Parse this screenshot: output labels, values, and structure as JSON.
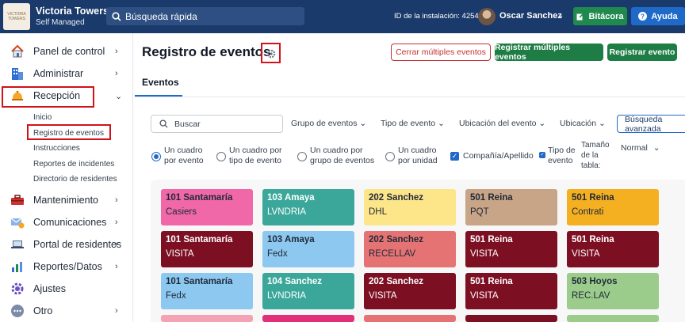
{
  "topbar": {
    "logo_text": "VICTORIA TOWERS",
    "brand_name": "Victoria Towers",
    "brand_sub": "Self Managed",
    "search_placeholder": "Búsqueda rápida",
    "install_id": "ID de la instalación: 4254",
    "user_name": "Oscar Sanchez",
    "bitacora_label": "Bitácora",
    "ayuda_label": "Ayuda",
    "colors": {
      "bar": "#1a3a6b",
      "bitacora": "#20894e",
      "ayuda": "#1f6ac9"
    }
  },
  "sidebar": {
    "items": [
      {
        "label": "Panel de control",
        "icon": "house-icon"
      },
      {
        "label": "Administrar",
        "icon": "building-icon"
      },
      {
        "label": "Recepción",
        "icon": "bell-icon"
      },
      {
        "label": "Mantenimiento",
        "icon": "toolbox-icon"
      },
      {
        "label": "Comunicaciones",
        "icon": "mail-icon"
      },
      {
        "label": "Portal de residentes",
        "icon": "laptop-icon"
      },
      {
        "label": "Reportes/Datos",
        "icon": "chart-icon"
      },
      {
        "label": "Ajustes",
        "icon": "gear-icon"
      },
      {
        "label": "Otro",
        "icon": "more-icon"
      }
    ],
    "sub_items": [
      "Inicio",
      "Registro de eventos",
      "Instrucciones",
      "Reportes de incidentes",
      "Directorio de residentes"
    ]
  },
  "main": {
    "title": "Registro de eventos",
    "buttons": {
      "close_multiple": "Cerrar múltiples eventos",
      "register_multiple": "Registrar múltiples eventos",
      "register": "Registrar evento"
    },
    "tab": "Eventos",
    "search_placeholder": "Buscar",
    "filters": [
      "Grupo de eventos",
      "Tipo de evento",
      "Ubicación del evento",
      "Ubicación"
    ],
    "advanced_search": "Búsqueda avanzada",
    "options": {
      "one_per_event": "Un cuadro por evento",
      "one_per_type": "Un cuadro por tipo de evento",
      "one_per_group": "Un cuadro por grupo de eventos",
      "one_per_unit": "Un cuadro por unidad",
      "company_surname": "Compañía/Apellido",
      "event_type": "Tipo de evento",
      "table_size_label": "Tamaño de la tabla:",
      "table_size_value": "Normal"
    },
    "cards": [
      {
        "unit": "101 Santamaría",
        "event": "Casiers",
        "bg": "#f068a8",
        "fg": "#1f2937"
      },
      {
        "unit": "103 Amaya",
        "event": "LVNDRIA",
        "bg": "#3aa79a",
        "fg": "#ffffff"
      },
      {
        "unit": "202 Sanchez",
        "event": "DHL",
        "bg": "#fde68a",
        "fg": "#1f2937"
      },
      {
        "unit": "501 Reina",
        "event": "PQT",
        "bg": "#c7a586",
        "fg": "#1f2937"
      },
      {
        "unit": "501 Reina",
        "event": "Contrati",
        "bg": "#f5b021",
        "fg": "#1f2937"
      },
      {
        "unit": "101 Santamaría",
        "event": "VISITA",
        "bg": "#7d0f23",
        "fg": "#ffffff"
      },
      {
        "unit": "103 Amaya",
        "event": "Fedx",
        "bg": "#8cc8f0",
        "fg": "#1f2937"
      },
      {
        "unit": "202 Sanchez",
        "event": "RECELLAV",
        "bg": "#e57373",
        "fg": "#1f2937"
      },
      {
        "unit": "501 Reina",
        "event": "VISITA",
        "bg": "#7d0f23",
        "fg": "#ffffff"
      },
      {
        "unit": "501 Reina",
        "event": "VISITA",
        "bg": "#7d0f23",
        "fg": "#ffffff"
      },
      {
        "unit": "101 Santamaría",
        "event": "Fedx",
        "bg": "#8cc8f0",
        "fg": "#1f2937"
      },
      {
        "unit": "104 Sanchez",
        "event": "LVNDRIA",
        "bg": "#3aa79a",
        "fg": "#ffffff"
      },
      {
        "unit": "202 Sanchez",
        "event": "VISITA",
        "bg": "#7d0f23",
        "fg": "#ffffff"
      },
      {
        "unit": "501 Reina",
        "event": "VISITA",
        "bg": "#7d0f23",
        "fg": "#ffffff"
      },
      {
        "unit": "503 Hoyos",
        "event": "REC.LAV",
        "bg": "#9ccc8c",
        "fg": "#1f2937"
      }
    ],
    "partial_row_colors": [
      "#f4a3b4",
      "#e0307a",
      "#e57373",
      "#7d0f23",
      "#9ccc8c"
    ]
  }
}
